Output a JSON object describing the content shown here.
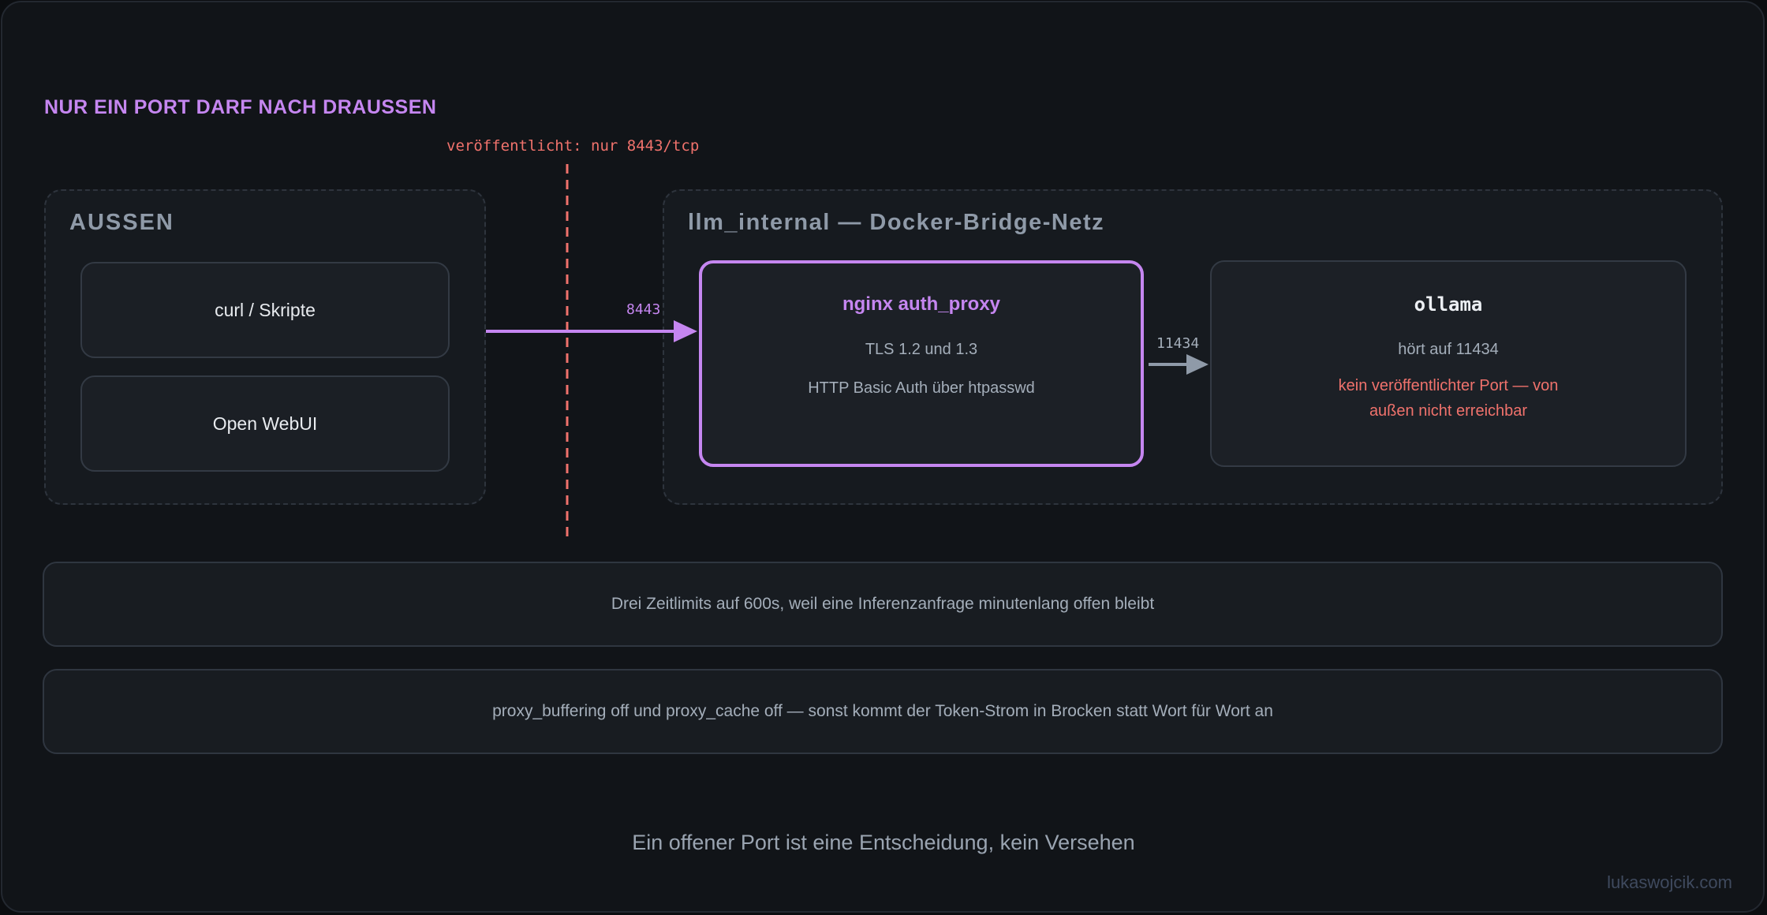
{
  "heading": "NUR EIN PORT DARF NACH DRAUSSEN",
  "boundary_label": "veröffentlicht: nur 8443/tcp",
  "outside": {
    "title": "AUSSEN",
    "clients": [
      "curl / Skripte",
      "Open WebUI"
    ]
  },
  "internal": {
    "title": "llm_internal — Docker-Bridge-Netz",
    "proxy": {
      "title": "nginx auth_proxy",
      "lines": [
        "TLS 1.2 und 1.3",
        "HTTP Basic Auth über htpasswd"
      ]
    },
    "ollama": {
      "title": "ollama",
      "line": "hört auf 11434",
      "warning": "kein veröffentlichter Port — von außen nicht erreichbar"
    }
  },
  "edges": {
    "client_to_proxy_port": "8443",
    "proxy_to_ollama_port": "11434"
  },
  "notes": [
    "Drei Zeitlimits auf 600s, weil eine Inferenzanfrage minutenlang offen bleibt",
    "proxy_buffering off und proxy_cache off — sonst kommt der Token-Strom in Brocken statt Wort für Wort an"
  ],
  "tagline": "Ein offener Port ist eine Entscheidung, kein Versehen",
  "watermark": "lukaswojcik.com",
  "colors": {
    "accent": "#c586f0",
    "warning": "#f0726c",
    "background": "#111418"
  }
}
